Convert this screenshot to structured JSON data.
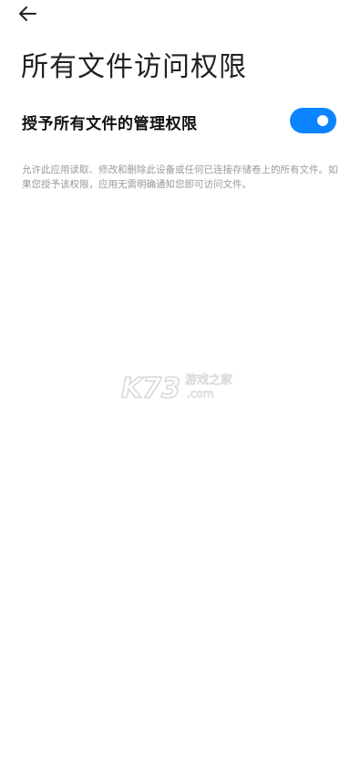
{
  "header": {
    "back_icon": "arrow-left-icon",
    "title": "所有文件访问权限"
  },
  "setting": {
    "label": "授予所有文件的管理权限",
    "toggle_on": true,
    "toggle_color": "#0d84ff"
  },
  "description": "允许此应用读取、修改和删除此设备或任何已连接存储卷上的所有文件。如果您授予该权限，应用无需明确通知您即可访问文件。",
  "watermark": {
    "brand": "K73",
    "line1": "游戏之家",
    "line2": ".com"
  }
}
